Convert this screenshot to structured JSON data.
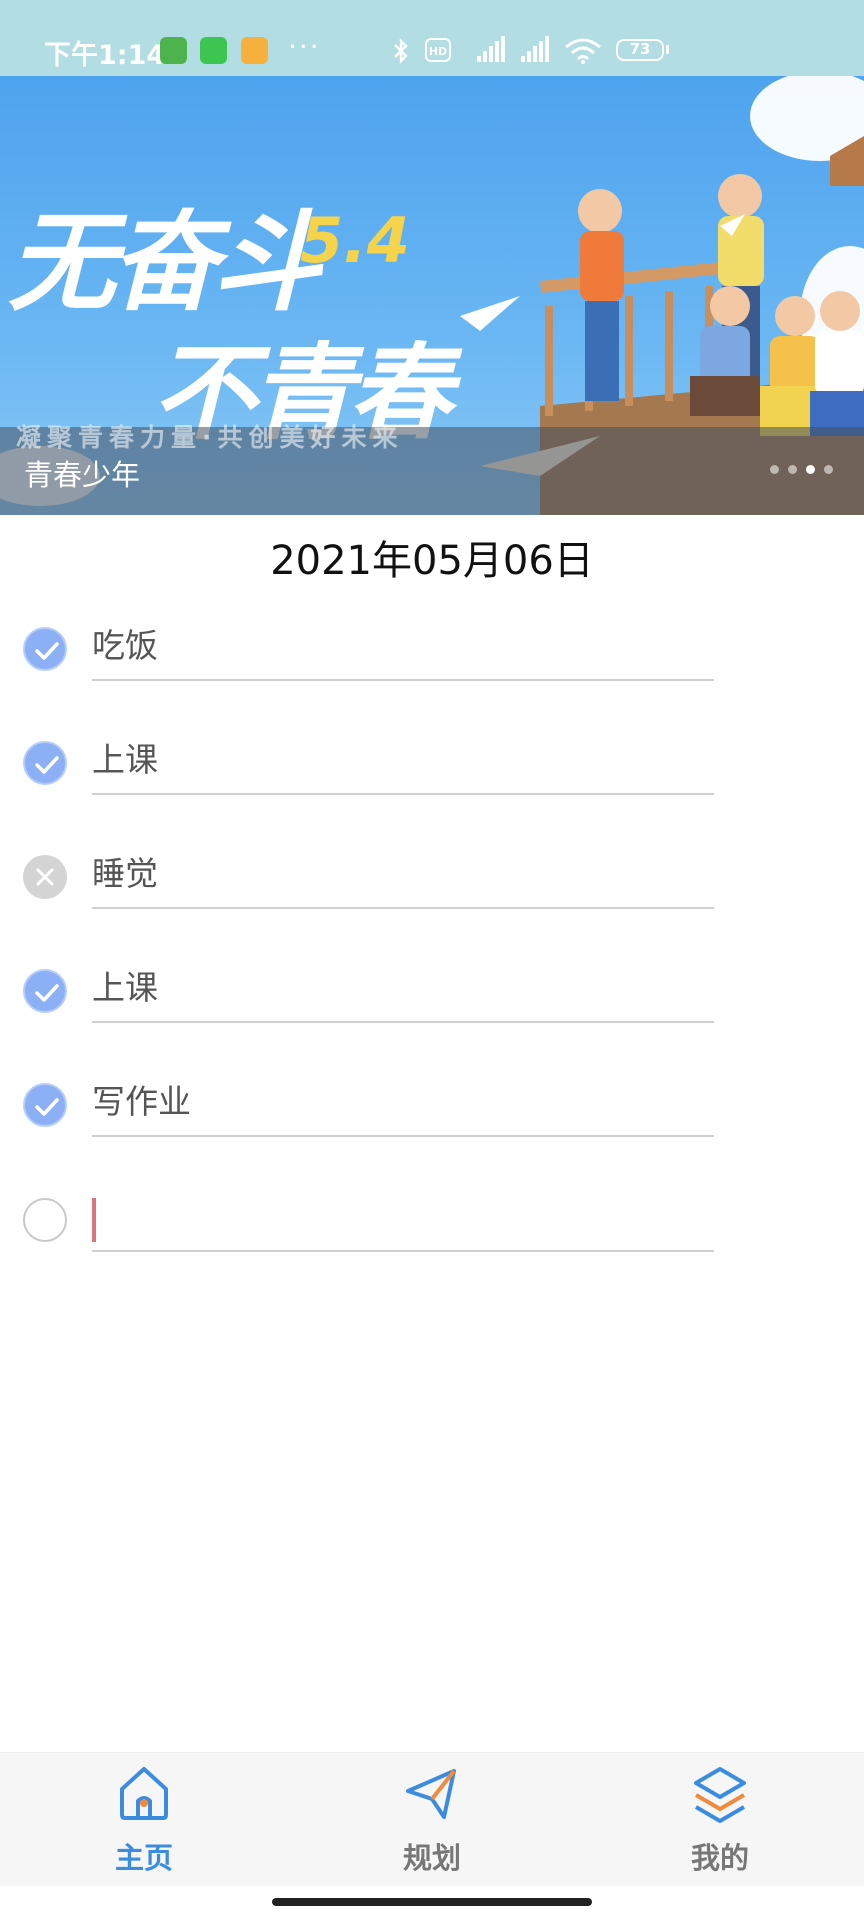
{
  "status_bar": {
    "time": "下午1:14",
    "battery": "73",
    "more": "···"
  },
  "banner": {
    "slogan_line1": "无奋斗",
    "slogan_line2": "不青春",
    "badge": "5.4",
    "subtitle": "凝聚青春力量·共创美好未来",
    "caption": "青春少年",
    "page_count": 4,
    "active_page": 3
  },
  "date": "2021年05月06日",
  "tasks": [
    {
      "text": "吃饭",
      "state": "done"
    },
    {
      "text": "上课",
      "state": "done"
    },
    {
      "text": "睡觉",
      "state": "cancelled"
    },
    {
      "text": "上课",
      "state": "done"
    },
    {
      "text": "写作业",
      "state": "done"
    },
    {
      "text": "",
      "state": "empty"
    }
  ],
  "nav": {
    "items": [
      {
        "label": "主页",
        "icon": "home-icon",
        "active": true
      },
      {
        "label": "规划",
        "icon": "paper-plane-icon",
        "active": false
      },
      {
        "label": "我的",
        "icon": "layers-icon",
        "active": false
      }
    ]
  },
  "colors": {
    "accent": "#3b8ce0",
    "status_bar": "#b1dde3",
    "check_done": "#8cb0f5",
    "check_cancel": "#d4d4d4",
    "caret": "#d9757b"
  }
}
